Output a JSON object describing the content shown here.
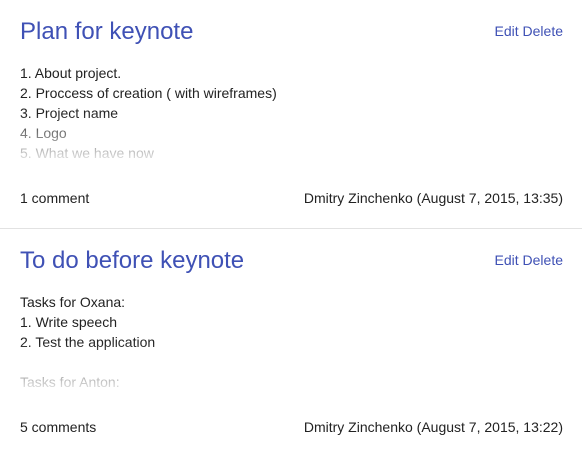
{
  "actions": {
    "edit_label": "Edit",
    "delete_label": "Delete"
  },
  "posts": [
    {
      "title": "Plan for keynote",
      "body_lines": [
        "1. About project.",
        "2. Proccess of creation ( with wireframes)",
        "3. Project name",
        "4. Logo",
        "5. What we have now"
      ],
      "comments": "1 comment",
      "author": "Dmitry Zinchenko",
      "date": "(August 7, 2015, 13:35)"
    },
    {
      "title": "To do before keynote",
      "body_lines": [
        "Tasks for Oxana:",
        "1. Write speech",
        "2. Test the application",
        "",
        "Tasks for Anton:"
      ],
      "comments": "5 comments",
      "author": "Dmitry Zinchenko",
      "date": "(August 7, 2015, 13:22)"
    }
  ],
  "colors": {
    "accent": "#3f51b5",
    "text": "#222222",
    "divider": "#e2e2e2"
  }
}
